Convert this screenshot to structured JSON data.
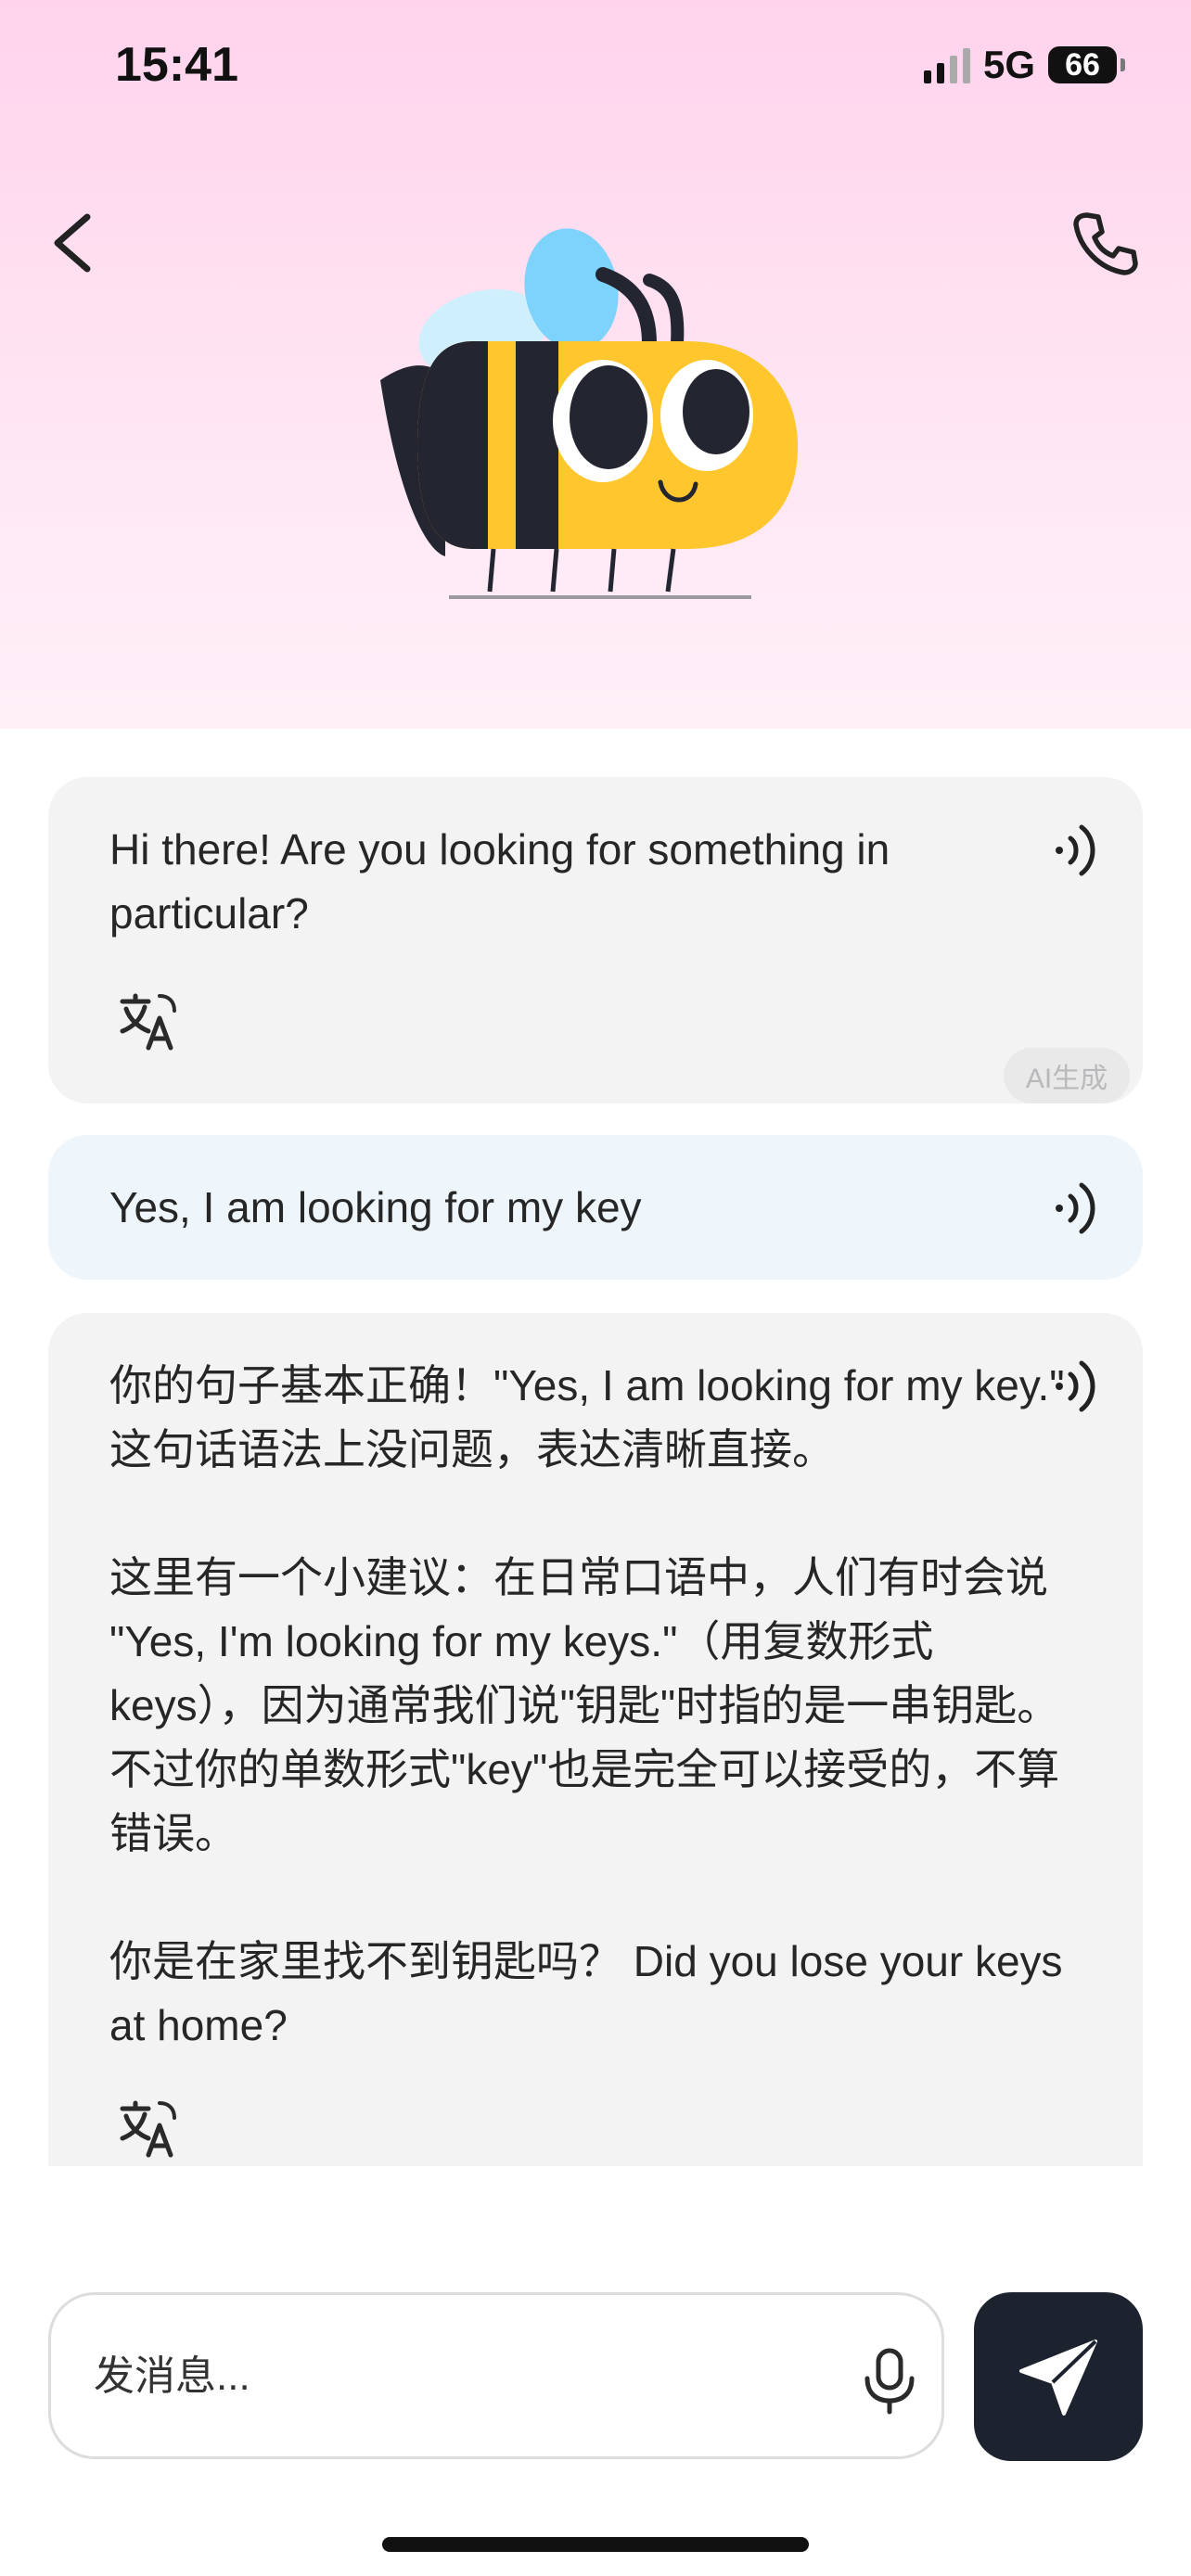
{
  "status_bar": {
    "time": "15:41",
    "network": "5G",
    "battery": "66"
  },
  "header": {
    "back_icon": "chevron-left-icon",
    "call_icon": "phone-icon",
    "avatar": "bee-avatar"
  },
  "messages": [
    {
      "role": "assistant",
      "text": "Hi there! Are you looking for something in particular?",
      "ai_tag": "AI生成"
    },
    {
      "role": "user",
      "text": "Yes, I am looking for my key"
    },
    {
      "role": "assistant",
      "text": "你的句子基本正确！\"Yes, I am looking for my key.\" 这句话语法上没问题，表达清晰直接。\n\n这里有一个小建议：在日常口语中，人们有时会说 \"Yes, I'm looking for my keys.\"（用复数形式keys），因为通常我们说\"钥匙\"时指的是一串钥匙。不过你的单数形式\"key\"也是完全可以接受的，不算错误。\n\n你是在家里找不到钥匙吗？ Did you lose your keys at home?"
    }
  ],
  "composer": {
    "placeholder": "发消息..."
  },
  "colors": {
    "header_gradient_top": "#ffd3ec",
    "assistant_bubble": "#f3f3f4",
    "user_bubble": "#eef6fb",
    "send_button": "#1d232e",
    "bee_yellow": "#ffc62e",
    "bee_dark": "#232631",
    "wing_blue": "#7dd3fb"
  }
}
